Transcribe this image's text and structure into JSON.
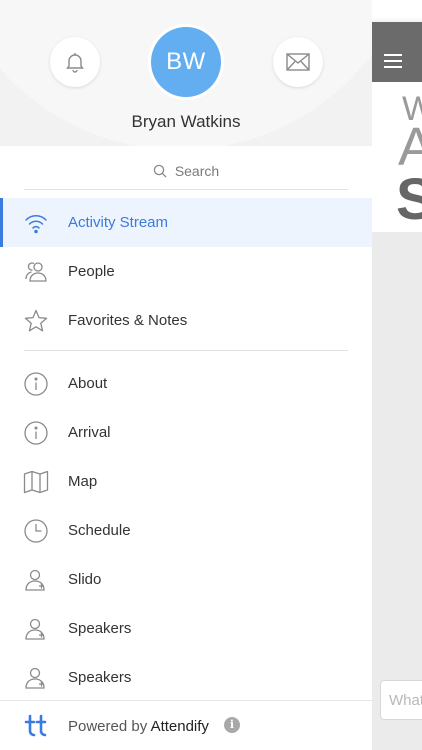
{
  "user": {
    "initials": "BW",
    "name": "Bryan Watkins"
  },
  "search": {
    "label": "Search"
  },
  "menu_primary": [
    {
      "label": "Activity Stream",
      "icon": "wifi-icon",
      "active": true
    },
    {
      "label": "People",
      "icon": "people-icon",
      "active": false
    },
    {
      "label": "Favorites & Notes",
      "icon": "star-icon",
      "active": false
    }
  ],
  "menu_secondary": [
    {
      "label": "About",
      "icon": "info-icon"
    },
    {
      "label": "Arrival",
      "icon": "info-icon"
    },
    {
      "label": "Map",
      "icon": "map-icon"
    },
    {
      "label": "Schedule",
      "icon": "clock-icon"
    },
    {
      "label": "Slido",
      "icon": "person-icon"
    },
    {
      "label": "Speakers",
      "icon": "person-icon"
    },
    {
      "label": "Speakers",
      "icon": "person-icon"
    }
  ],
  "footer": {
    "powered_by": "Powered by",
    "brand": "Attendify"
  },
  "background_app": {
    "hero_line1": "W",
    "hero_line2": "A",
    "hero_line3": "S",
    "input_placeholder": "What"
  },
  "colors": {
    "accent": "#3a7be0",
    "avatar": "#62aef0",
    "active_bg": "#eef4fd"
  }
}
